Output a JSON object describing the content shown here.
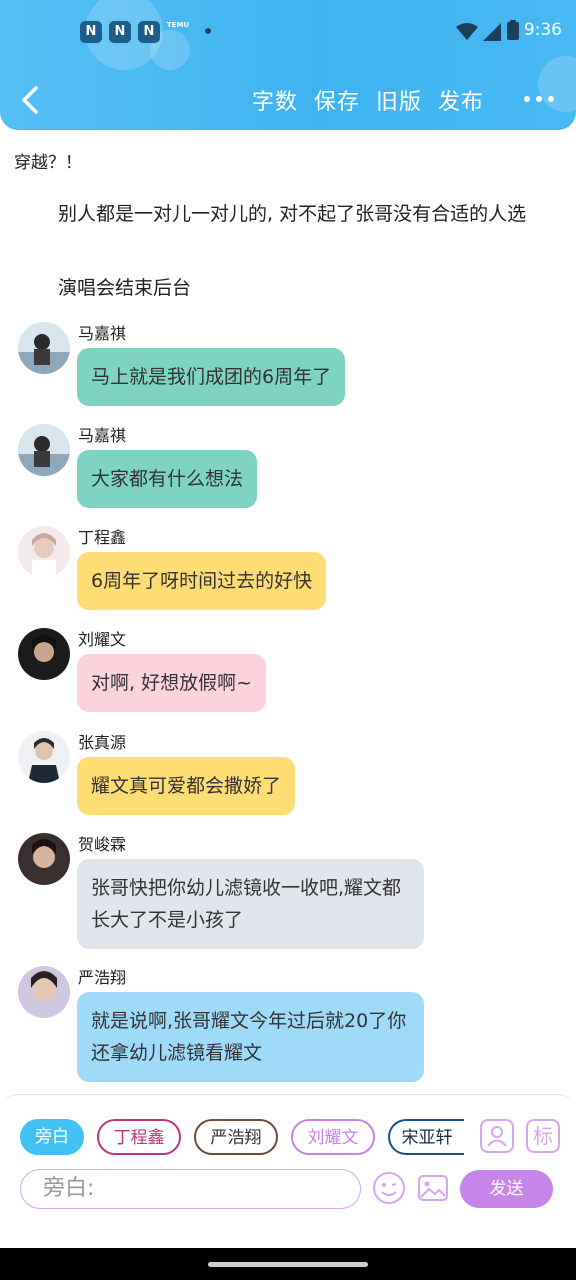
{
  "status_bar": {
    "time": "9:36",
    "temu_label": "TEMU"
  },
  "toolbar": {
    "actions": [
      "字数",
      "保存",
      "旧版",
      "发布"
    ]
  },
  "story": {
    "intro": "穿越？！",
    "paragraph1": "别人都是一对儿一对儿的, 对不起了张哥没有合适的人选",
    "paragraph2": "演唱会结束后台"
  },
  "messages": [
    {
      "name": "马嘉祺",
      "text": "马上就是我们成团的6周年了",
      "color": "#7fd3c3"
    },
    {
      "name": "马嘉祺",
      "text": "大家都有什么想法",
      "color": "#7fd3c3"
    },
    {
      "name": "丁程鑫",
      "text": "6周年了呀时间过去的好快",
      "color": "#ffdd75"
    },
    {
      "name": "刘耀文",
      "text": "对啊, 好想放假啊~",
      "color": "#fcd3dd"
    },
    {
      "name": "张真源",
      "text": "耀文真可爱都会撒娇了",
      "color": "#ffdd75"
    },
    {
      "name": "贺峻霖",
      "text": "张哥快把你幼儿滤镜收一收吧,耀文都长大了不是小孩了",
      "color": "#e1e6ec"
    },
    {
      "name": "严浩翔",
      "text": "就是说啊,张哥耀文今年过后就20了你还拿幼儿滤镜看耀文",
      "color": "#9fdaf8"
    }
  ],
  "characters": [
    {
      "label": "旁白",
      "color": "#42c1f4"
    },
    {
      "label": "丁程鑫",
      "color": "#b8367d"
    },
    {
      "label": "严浩翔",
      "color": "#6d4a3a"
    },
    {
      "label": "刘耀文",
      "color": "#c982e8"
    },
    {
      "label": "宋亚轩",
      "color": "#1d4e8f"
    }
  ],
  "input": {
    "placeholder": "旁白:"
  },
  "buttons": {
    "send": "发送",
    "tag": "标"
  }
}
